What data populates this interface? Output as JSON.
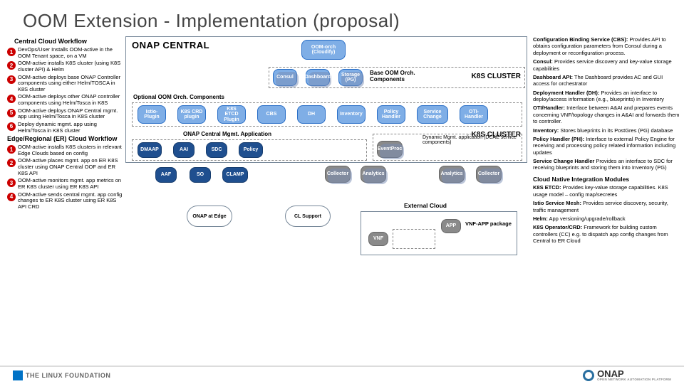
{
  "title": "OOM Extension - Implementation (proposal)",
  "left": {
    "section1": "Central Cloud Workflow",
    "steps1": [
      "DevOps/User Installs OOM-active in the OOM Tenant space, on a VM",
      "OOM-active installs K8S cluster (using K8S cluster API) & Helm",
      "OOM-active deploys base ONAP Controller components using either Helm/TOSCA in K8S cluster",
      "OOM-active deploys other ONAP controller components using Helm/Tosca in K8S",
      "OOM-active deploys ONAP Central mgmt. app using Helm/Tosca in K8S cluster",
      "Deploy dynamic mgmt. app using Helm/Tosca in K8S cluster"
    ],
    "section2": "Edge/Regional (ER) Cloud Workflow",
    "steps2": [
      "OOM-active installs K8S clusters in relevant Edge Clouds based on config",
      "OOM-active places mgmt. app on ER K8S cluster using ONAP Central OOF and ER K8S API",
      "OOM-active monitors mgmt. app metrics on ER K8S cluster using ER K8S API",
      "OOM-active sends central mgmt. app config changes to ER K8S cluster using ER K8S API CRD"
    ]
  },
  "center": {
    "oc_title": "ONAP CENTRAL",
    "oom_orch": "OOM-orch (Cloudify)",
    "consul": "Consul",
    "dashboard": "Dashboard",
    "storage": "Storage (PG)",
    "base_label": "Base OOM Orch. Components",
    "k8s1": "K8S CLUSTER",
    "opt_label": "Optional OOM Orch. Components",
    "istio": "Istio-Plugin",
    "k8s_crd": "K8S CRD plugin",
    "k8s_etcd": "K8S ETCD Plugin",
    "cbs": "CBS",
    "dh": "DH",
    "inventory": "Inventory",
    "policy_h": "Policy Handler",
    "service_ch": "Service Change",
    "oti_h": "OTI-Handler",
    "mgmt_label": "ONAP Central Mgmt. Application",
    "k8s2": "K8S CLUSTER",
    "dmaap": "DMAAP",
    "aai": "AAI",
    "sdc": "SDC",
    "policy": "Policy",
    "aaf": "AAF",
    "so": "SO",
    "clamp": "CLAMP",
    "collector": "Collector",
    "analytics": "Analytics",
    "eventproc": "EventProc",
    "dyn_label": "Dynamic Mgmt. application (DCAE service components)",
    "analytics2": "Analytics",
    "collector2": "Collector",
    "external": "External Cloud",
    "vnf": "VNF",
    "app": "APP",
    "vnf_pkg": "VNF-APP package",
    "edge_box": "ONAP at Edge",
    "cl_support": "CL Support"
  },
  "right": {
    "items": [
      "<b>Configuration Binding Service (CBS):</b> Provides API to obtains configuration parameters from Consul during a deployment or reconfiguration process.",
      "<b>Consul:</b> Provides service discovery and key-value storage capabilities",
      "<b>Dashboard API:</b> The Dashboard provides AC and GUI access for orchestrator",
      "<b>Deployment Handler (DH):</b> Provides an interface to deploy/access information (e.g., blueprints) in Inventory",
      "<b>OTI/Handler:</b> Interface between A&AI and prepares events concerning VNF/topology changes in A&AI and forwards them to controller.",
      "<b>Inventory:</b> Stores blueprints in its PostGres (PG) database",
      "<b>Policy Handler (PH):</b> Interface to external Policy Engine for receiving and processing policy related information including updates",
      "<b>Service Change Handler</b> Provides an interface to SDC for receiving blueprints and storing them into Inventory (PG)"
    ],
    "hdr": "Cloud Native Integration Modules",
    "items2": [
      "<b>K8S ETCD:</b> Provides key-value storage capabilities. K8S usage model – config map/secretes",
      "<b>Istio Service Mesh:</b> Provides service discovery, security, traffic management",
      "<b>Helm:</b> App versioning/upgrade/rollback",
      "<b>K8S Operator/CRD:</b> Framework for building custom controllers (CC) e.g. to dispatch app config changes from Central to ER Cloud"
    ]
  },
  "footer": {
    "lf": "THE LINUX FOUNDATION",
    "onap": "ONAP",
    "onap_sub": "OPEN NETWORK AUTOMATION PLATFORM"
  }
}
